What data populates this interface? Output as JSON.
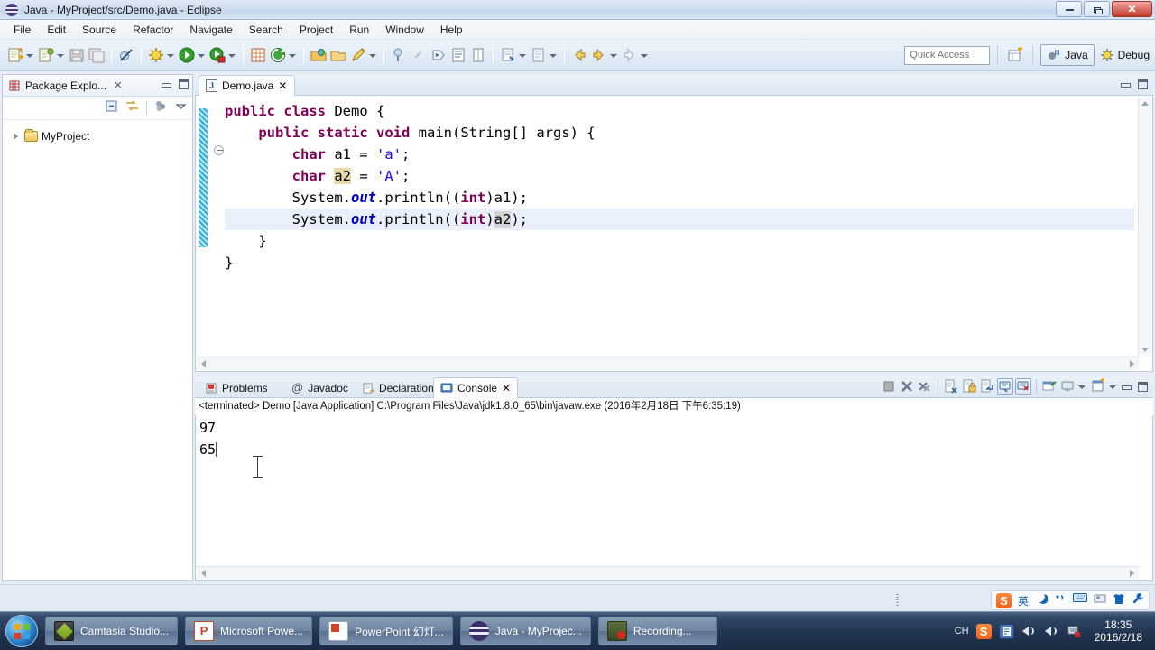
{
  "window": {
    "title": "Java - MyProject/src/Demo.java - Eclipse",
    "app_icon": "eclipse-icon",
    "controls": {
      "minimize": "minimize-button",
      "restore": "restore-button",
      "close": "close-button",
      "close_glyph": "✕"
    }
  },
  "menubar": {
    "items": [
      "File",
      "Edit",
      "Source",
      "Refactor",
      "Navigate",
      "Search",
      "Project",
      "Run",
      "Window",
      "Help"
    ]
  },
  "toolbar": {
    "quick_access_placeholder": "Quick Access",
    "quick_access_value": "",
    "perspectives": [
      {
        "label": "Java",
        "active": true
      },
      {
        "label": "Debug",
        "active": false
      }
    ],
    "icons": [
      "new-wizard-icon",
      "new-java-project-icon",
      "save-icon",
      "save-all-icon",
      "skip-breakpoints-icon",
      "debug-icon",
      "run-icon",
      "coverage-icon",
      "new-java-class-icon",
      "external-tools-icon",
      "open-type-icon",
      "open-task-icon",
      "search-icon",
      "pencil-icon",
      "annotation-icon",
      "next-annotation-icon",
      "previous-edit-icon",
      "toggle-mark-occurrences-icon",
      "outline-icon",
      "back-icon",
      "forward-icon"
    ]
  },
  "package_explorer": {
    "tab_label": "Package Explo...",
    "tab_icon": "package-explorer-icon",
    "close_glyph": "✕",
    "toolbar_icons": [
      "collapse-all-icon",
      "link-with-editor-icon",
      "view-menu-icon",
      "view-dropdown-icon"
    ],
    "tree": [
      {
        "label": "MyProject",
        "icon": "project-folder-icon",
        "expanded": false
      }
    ]
  },
  "editor": {
    "tab_label": "Demo.java",
    "tab_icon": "java-file-icon",
    "close_glyph": "✕",
    "file_type_letter": "J",
    "code_lines": [
      {
        "indent": 0,
        "tokens": [
          {
            "t": "public",
            "c": "kw"
          },
          {
            "t": " ",
            "c": "plain"
          },
          {
            "t": "class",
            "c": "kw"
          },
          {
            "t": " Demo {",
            "c": "plain"
          }
        ]
      },
      {
        "indent": 1,
        "tokens": [
          {
            "t": "public",
            "c": "kw"
          },
          {
            "t": " ",
            "c": "plain"
          },
          {
            "t": "static",
            "c": "kw"
          },
          {
            "t": " ",
            "c": "plain"
          },
          {
            "t": "void",
            "c": "kw"
          },
          {
            "t": " main(String[] args) {",
            "c": "plain"
          }
        ]
      },
      {
        "indent": 2,
        "tokens": [
          {
            "t": "char",
            "c": "kw"
          },
          {
            "t": " a1 = ",
            "c": "plain"
          },
          {
            "t": "'a'",
            "c": "str"
          },
          {
            "t": ";",
            "c": "plain"
          }
        ]
      },
      {
        "indent": 2,
        "tokens": [
          {
            "t": "char",
            "c": "kw"
          },
          {
            "t": " ",
            "c": "plain"
          },
          {
            "t": "a2",
            "c": "plain hl-occ"
          },
          {
            "t": " = ",
            "c": "plain"
          },
          {
            "t": "'A'",
            "c": "str"
          },
          {
            "t": ";",
            "c": "plain"
          }
        ]
      },
      {
        "indent": 2,
        "tokens": [
          {
            "t": "System.",
            "c": "plain"
          },
          {
            "t": "out",
            "c": "fld"
          },
          {
            "t": ".println((",
            "c": "plain"
          },
          {
            "t": "int",
            "c": "kw"
          },
          {
            "t": ")a1);",
            "c": "plain"
          }
        ]
      },
      {
        "indent": 2,
        "tokens": [
          {
            "t": "System.",
            "c": "plain"
          },
          {
            "t": "out",
            "c": "fld"
          },
          {
            "t": ".println(",
            "c": "plain"
          },
          {
            "t": "(",
            "c": "plain"
          },
          {
            "t": "int",
            "c": "kw"
          },
          {
            "t": ")",
            "c": "plain"
          },
          {
            "t": "a2",
            "c": "plain hl-occ2"
          },
          {
            "t": ");",
            "c": "plain"
          }
        ]
      },
      {
        "indent": 1,
        "tokens": [
          {
            "t": "}",
            "c": "plain"
          }
        ]
      },
      {
        "indent": 0,
        "tokens": [
          {
            "t": "}",
            "c": "plain"
          }
        ]
      }
    ],
    "current_line_index": 5,
    "colors": {
      "keyword": "#7f0055",
      "string": "#2a00ff",
      "field": "#0000c0",
      "occurrence_highlight": "#e8d9a8",
      "selection_highlight": "#d4d4d4",
      "current_line": "#eaf0fb"
    }
  },
  "console": {
    "tabs": [
      {
        "label": "Problems",
        "icon": "problems-icon",
        "active": false
      },
      {
        "label": "Javadoc",
        "icon": "javadoc-icon",
        "active": false
      },
      {
        "label": "Declaration",
        "icon": "declaration-icon",
        "active": false
      },
      {
        "label": "Console",
        "icon": "console-icon",
        "active": true
      }
    ],
    "close_glyph": "✕",
    "status_line": "<terminated> Demo [Java Application] C:\\Program Files\\Java\\jdk1.8.0_65\\bin\\javaw.exe (2016年2月18日 下午6:35:19)",
    "output_lines": [
      "97",
      "65"
    ],
    "toolbar_icons": [
      "terminate-icon",
      "remove-launch-icon",
      "remove-all-terminated-icon",
      "clear-console-icon",
      "scroll-lock-icon",
      "word-wrap-icon",
      "show-console-on-output-icon",
      "show-console-on-error-icon",
      "pin-console-icon",
      "display-selected-console-icon",
      "open-console-icon",
      "minimize-icon",
      "maximize-icon"
    ]
  },
  "tray_ime": {
    "items": [
      "sogou-logo-icon",
      "英",
      "moon-icon",
      "punctuation-icon",
      "keyboard-icon",
      "user-card-icon",
      "skin-icon",
      "tools-icon"
    ],
    "mode_label": "英"
  },
  "taskbar": {
    "start_label": "start-orb",
    "items": [
      {
        "label": "Camtasia Studio...",
        "icon": "camtasia-icon"
      },
      {
        "label": "Microsoft Powe...",
        "icon": "powerpoint-icon"
      },
      {
        "label": "PowerPoint 幻灯...",
        "icon": "powerpoint-doc-icon"
      },
      {
        "label": "Java - MyProjec...",
        "icon": "eclipse-icon"
      },
      {
        "label": "Recording...",
        "icon": "recording-icon"
      }
    ],
    "tray": {
      "language": "CH",
      "icons": [
        "sogou-logo-icon",
        "eclipse-tray-icon",
        "volume-icon",
        "volume-2-icon",
        "network-icon"
      ],
      "time": "18:35",
      "date": "2016/2/18"
    }
  }
}
